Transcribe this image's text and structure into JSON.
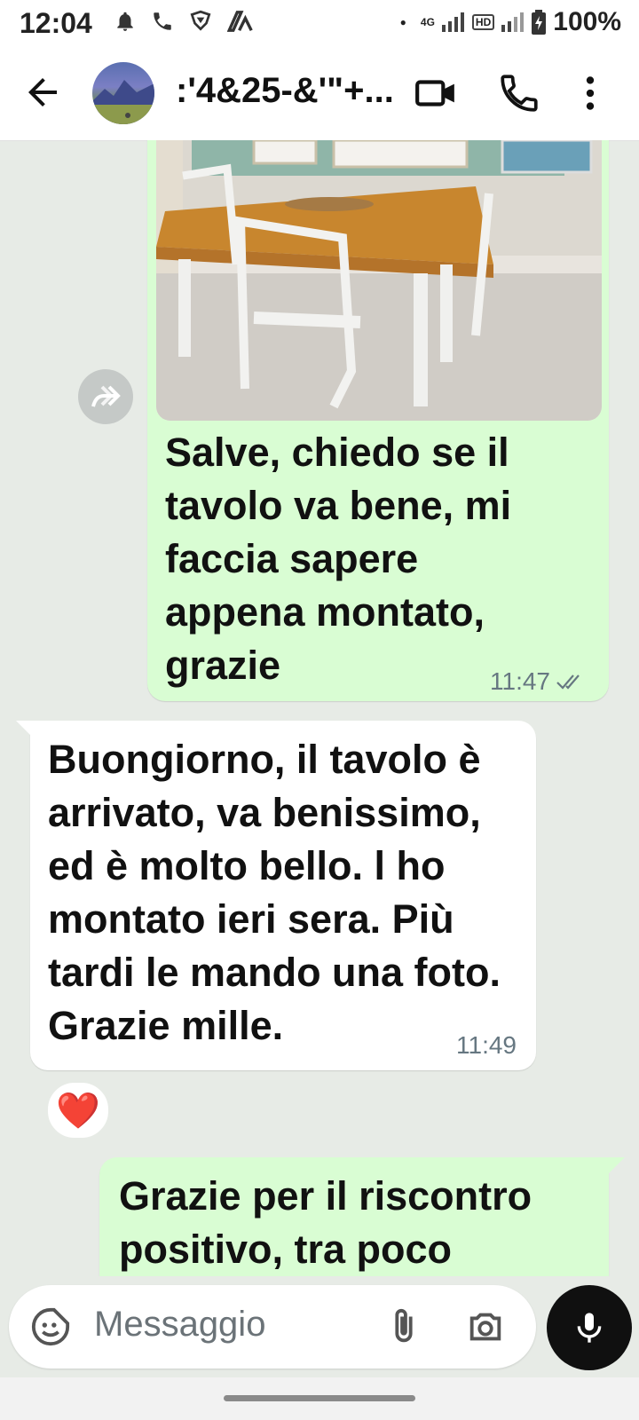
{
  "status_bar": {
    "time": "12:04",
    "network": "4G",
    "hd": "HD",
    "battery": "100%"
  },
  "header": {
    "contact_name": ":'4&25-&'\"+...",
    "icons": [
      "back-arrow-icon",
      "video-call-icon",
      "phone-icon",
      "more-options-icon"
    ]
  },
  "messages": [
    {
      "direction": "outgoing",
      "has_photo": true,
      "text": "Salve, chiedo se il tavolo va bene, mi faccia sapere appena montato, grazie",
      "time": "11:47",
      "status": "read"
    },
    {
      "direction": "incoming",
      "text": "Buongiorno, il tavolo è arrivato, va benissimo, ed è molto bello. l ho montato ieri sera. Più tardi le mando una foto. Grazie mille.",
      "time": "11:49",
      "reaction": "❤️"
    },
    {
      "direction": "outgoing",
      "text": "Grazie per il riscontro positivo, tra poco"
    }
  ],
  "composer": {
    "placeholder": "Messaggio"
  },
  "colors": {
    "chat_background": "#e7ebe6",
    "outgoing_bubble": "#d9fdd3",
    "incoming_bubble": "#ffffff",
    "mic_button": "#101010"
  }
}
